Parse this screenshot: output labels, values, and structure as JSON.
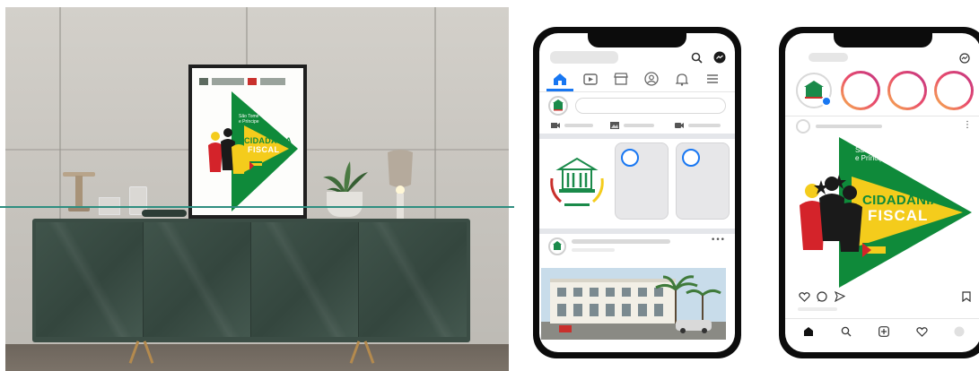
{
  "poster": {
    "region_text": "São Tomé\ne Príncipe",
    "title_line1": "CIDADANIA",
    "title_line2": "FISCAL"
  },
  "instagram_post": {
    "region_text": "São Tomé\ne Príncipe",
    "title_line1": "CIDADANIA",
    "title_line2": "FISCAL"
  },
  "colors": {
    "brand_green": "#0f8a3a",
    "brand_yellow": "#f4cc1c",
    "flag_red": "#d4232a",
    "facebook_blue": "#1877f2",
    "teal_guide": "#2f8e80",
    "sideboard": "#3b4d45"
  },
  "facebook_mockup": {
    "top_icons": [
      "search-icon",
      "messenger-icon"
    ],
    "nav_icons": [
      "home-icon",
      "video-icon",
      "marketplace-icon",
      "profile-icon",
      "bell-icon",
      "menu-icon"
    ],
    "composer_icons": [
      "live-video-icon",
      "photo-icon",
      "room-icon"
    ],
    "post_more": "•••"
  },
  "instagram_mockup": {
    "post_more": "⋮",
    "action_icons": [
      "heart-icon",
      "comment-icon",
      "share-icon",
      "bookmark-icon"
    ],
    "bottom_icons": [
      "home-icon",
      "search-icon",
      "add-icon",
      "heart-icon",
      "profile-icon"
    ]
  }
}
